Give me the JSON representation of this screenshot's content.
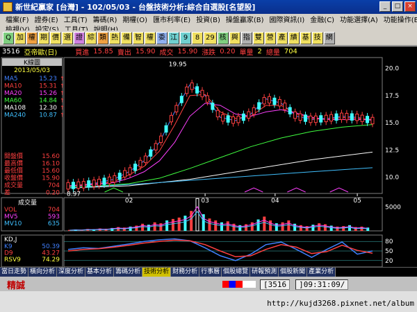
{
  "window": {
    "title": "新世紀贏家 [台灣] - 102/05/03 - 台盤技術分析:綜合自選股[名望股]",
    "minimize": "_",
    "maximize": "□",
    "close": "×"
  },
  "menu": {
    "row1": [
      "檔案(F)",
      "證券(E)",
      "工具(T)",
      "籌碼(R)",
      "期權(O)",
      "匯市利率(E)",
      "投資(B)",
      "操盤贏家(B)",
      "國際資訊(I)",
      "金融(C)",
      "功能選擇(A)",
      "功能操作(E)"
    ],
    "row2": [
      "檢視(V)",
      "設定(S)",
      "工具(T)",
      "說明(H)"
    ]
  },
  "toolbar": {
    "buttons": [
      "Q",
      "加",
      "權",
      "期",
      "價",
      "選",
      "證",
      "綜",
      "類",
      "熱",
      "備",
      "智",
      "權",
      "委",
      "江",
      "9",
      "8",
      "29",
      "核",
      "興",
      "指",
      "雙",
      "營",
      "產",
      "績",
      "基",
      "技",
      "網"
    ]
  },
  "quote": {
    "code": "3516",
    "name": "亞帝歐(日)",
    "bid_label": "買進",
    "bid": "15.85",
    "ask_label": "賣出",
    "ask": "15.90",
    "last_label": "成交",
    "last": "15.90",
    "change_label": "漲跌",
    "change": "0.20",
    "vol_label": "單量",
    "vol": "2",
    "total_label": "總量",
    "total": "704"
  },
  "legend": {
    "header": "K線圖",
    "date": "2013/05/03",
    "ma": [
      {
        "name": "MA5",
        "value": "15.23",
        "color": "#4080ff"
      },
      {
        "name": "MA10",
        "value": "15.31",
        "color": "#ff4040"
      },
      {
        "name": "MA20",
        "value": "15.26",
        "color": "#ff40ff"
      },
      {
        "name": "MA60",
        "value": "14.84",
        "color": "#40ff40"
      },
      {
        "name": "MA108",
        "value": "12.30",
        "color": "#ffffff"
      },
      {
        "name": "MA240",
        "value": "10.87",
        "color": "#40c0ff"
      }
    ],
    "stats": [
      {
        "name": "開盤價",
        "value": "15.60"
      },
      {
        "name": "最高價",
        "value": "16.10"
      },
      {
        "name": "最低價",
        "value": "15.60"
      },
      {
        "name": "收盤價",
        "value": "15.90"
      },
      {
        "name": "成交量",
        "value": "704"
      },
      {
        "name": "差",
        "value": "0.20"
      }
    ]
  },
  "volume_legend": {
    "header": "成交量",
    "items": [
      {
        "name": "VOL",
        "value": "704",
        "color": "#ff4040"
      },
      {
        "name": "MV5",
        "value": "593",
        "color": "#ff40ff"
      },
      {
        "name": "MV10",
        "value": "635",
        "color": "#40c0ff"
      }
    ]
  },
  "kd_legend": {
    "header": "KD,J",
    "items": [
      {
        "name": "K9",
        "value": "50.39",
        "color": "#4080ff"
      },
      {
        "name": "D9",
        "value": "43.27",
        "color": "#ff4040"
      },
      {
        "name": "RSV9",
        "value": "74.29",
        "color": "#ffff40"
      }
    ]
  },
  "chart_data": [
    {
      "type": "line",
      "title": "K線圖",
      "x_ticks": [
        "02",
        "03",
        "04",
        "05"
      ],
      "y_ticks": [
        "20.0",
        "17.5",
        "15.0",
        "12.5",
        "10.0"
      ],
      "ylim": [
        8.5,
        21
      ],
      "annotations": [
        "19.95",
        "8.97"
      ],
      "series": [
        {
          "name": "MA5",
          "x": [
            0,
            5,
            10,
            15,
            20,
            25,
            30,
            35,
            40,
            45,
            50,
            55,
            60,
            65,
            70,
            75,
            80,
            85,
            90,
            95,
            100
          ],
          "values": [
            9.2,
            9.3,
            9.5,
            9.8,
            10.5,
            11.5,
            13.2,
            16.0,
            18.5,
            17.5,
            15.5,
            15.2,
            15.8,
            17.2,
            16.8,
            15.6,
            15.3,
            15.4,
            15.6,
            15.5,
            15.2
          ]
        },
        {
          "name": "MA10",
          "x": [
            0,
            5,
            10,
            15,
            20,
            25,
            30,
            35,
            40,
            45,
            50,
            55,
            60,
            65,
            70,
            75,
            80,
            85,
            90,
            95,
            100
          ],
          "values": [
            9.2,
            9.3,
            9.4,
            9.6,
            10.2,
            11.0,
            12.4,
            14.8,
            17.5,
            17.6,
            16.0,
            15.4,
            15.6,
            16.6,
            16.6,
            15.8,
            15.4,
            15.3,
            15.5,
            15.4,
            15.3
          ]
        },
        {
          "name": "MA20",
          "x": [
            0,
            5,
            10,
            15,
            20,
            25,
            30,
            35,
            40,
            45,
            50,
            55,
            60,
            65,
            70,
            75,
            80,
            85,
            90,
            95,
            100
          ],
          "values": [
            9.2,
            9.25,
            9.35,
            9.5,
            9.9,
            10.5,
            11.5,
            13.2,
            15.6,
            16.8,
            16.6,
            15.8,
            15.6,
            16.0,
            16.2,
            15.9,
            15.5,
            15.3,
            15.3,
            15.3,
            15.26
          ]
        },
        {
          "name": "MA60",
          "x": [
            0,
            10,
            20,
            30,
            40,
            50,
            60,
            70,
            80,
            90,
            100
          ],
          "values": [
            9.1,
            9.2,
            9.4,
            9.9,
            10.8,
            11.8,
            12.8,
            13.6,
            14.2,
            14.6,
            14.84
          ]
        },
        {
          "name": "MA108",
          "x": [
            0,
            20,
            40,
            60,
            80,
            100
          ],
          "values": [
            9.0,
            9.2,
            9.8,
            10.7,
            11.6,
            12.3
          ]
        },
        {
          "name": "MA240",
          "x": [
            0,
            25,
            50,
            75,
            100
          ],
          "values": [
            9.0,
            9.4,
            9.9,
            10.4,
            10.87
          ]
        }
      ]
    },
    {
      "type": "bar",
      "title": "成交量",
      "y_ticks": [
        "5000"
      ],
      "ylim": [
        0,
        7000
      ],
      "values": [
        200,
        300,
        250,
        400,
        350,
        500,
        450,
        600,
        800,
        700,
        900,
        1100,
        1500,
        1300,
        1800,
        1600,
        2200,
        2500,
        2800,
        3200,
        4200,
        6800,
        3500,
        2600,
        2200,
        1800,
        2000,
        1500,
        1200,
        1400,
        1800,
        2400,
        3000,
        2200,
        1600,
        1800,
        2200,
        1500,
        1200,
        1000,
        1300,
        1600,
        1400,
        1100,
        900,
        1000,
        1200,
        800,
        900,
        700
      ]
    },
    {
      "type": "line",
      "title": "KD,J",
      "y_ticks": [
        "80",
        "50",
        "20"
      ],
      "ylim": [
        0,
        100
      ],
      "series": [
        {
          "name": "K9",
          "x": [
            0,
            5,
            10,
            15,
            20,
            25,
            30,
            35,
            40,
            45,
            50,
            55,
            60,
            65,
            70,
            75,
            80,
            85,
            90,
            95,
            100
          ],
          "values": [
            55,
            60,
            58,
            65,
            72,
            80,
            85,
            88,
            82,
            60,
            35,
            20,
            40,
            70,
            78,
            55,
            30,
            55,
            78,
            40,
            50
          ]
        },
        {
          "name": "D9",
          "x": [
            0,
            5,
            10,
            15,
            20,
            25,
            30,
            35,
            40,
            45,
            50,
            55,
            60,
            65,
            70,
            75,
            80,
            85,
            90,
            95,
            100
          ],
          "values": [
            50,
            55,
            57,
            62,
            68,
            75,
            80,
            84,
            82,
            70,
            50,
            32,
            35,
            55,
            70,
            62,
            42,
            48,
            68,
            52,
            43
          ]
        }
      ]
    }
  ],
  "bottom_tabs": [
    "當日走勢",
    "橫向分析",
    "深度分析",
    "基本分析",
    "籌碼分析",
    "技術分析",
    "財務分析",
    "行事曆",
    "個股總覽",
    "研報預測",
    "個股新聞",
    "產業分析"
  ],
  "active_tab": "技術分析",
  "status": {
    "label": "精誠",
    "code": "[3516",
    "time": "]09:31:09/"
  },
  "url": "http://kujd3268.pixnet.net/album"
}
